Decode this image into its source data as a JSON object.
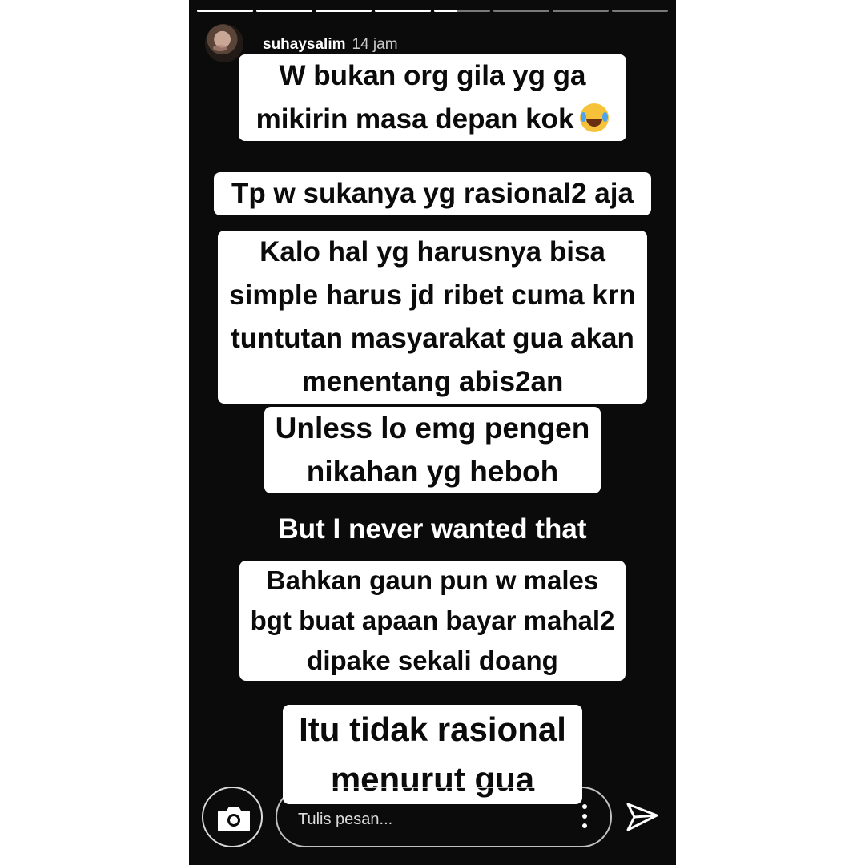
{
  "story": {
    "username": "suhaysalim",
    "time": "14 jam",
    "progress_segments": [
      1,
      1,
      1,
      1,
      0.4,
      0,
      0,
      0
    ]
  },
  "messages": {
    "m1": {
      "lines": [
        "W bukan org gila yg ga",
        "mikirin masa depan kok"
      ],
      "emoji": "face-with-tears-of-joy"
    },
    "m2": {
      "lines": [
        "Tp w sukanya yg rasional2 aja"
      ]
    },
    "m3": {
      "lines": [
        "Kalo hal yg harusnya bisa",
        "simple harus jd ribet cuma krn",
        "tuntutan masyarakat gua akan",
        "menentang abis2an"
      ]
    },
    "m4": {
      "lines": [
        "Unless lo emg pengen",
        "nikahan yg heboh"
      ]
    },
    "m5": {
      "lines": [
        "But I never wanted that"
      ]
    },
    "m6": {
      "lines": [
        "Bahkan gaun pun w males",
        "bgt buat apaan bayar mahal2",
        "dipake sekali doang"
      ]
    },
    "m7": {
      "lines": [
        "Itu tidak rasional",
        "menurut gua"
      ]
    }
  },
  "footer": {
    "reply_placeholder": "Tulis pesan...",
    "camera_icon": "camera-icon",
    "more_icon": "more-vertical-icon",
    "send_icon": "send-icon"
  }
}
